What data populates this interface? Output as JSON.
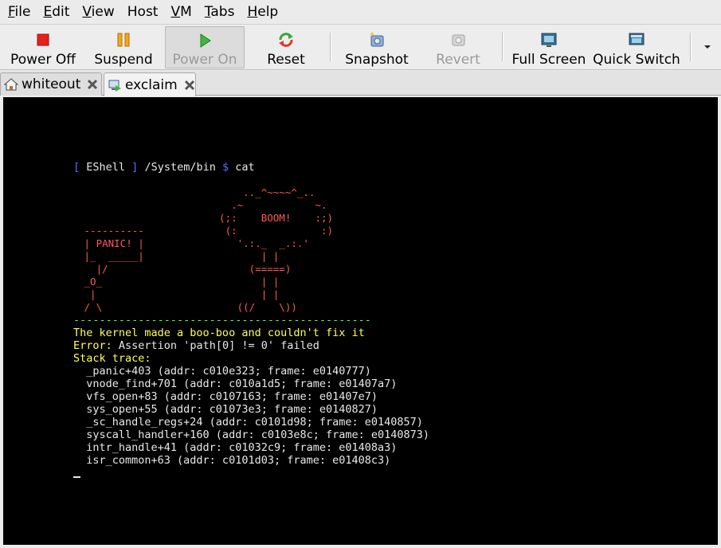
{
  "menu": [
    {
      "u": "F",
      "rest": "ile"
    },
    {
      "u": "E",
      "rest": "dit"
    },
    {
      "u": "V",
      "rest": "iew"
    },
    {
      "u": "H",
      "rest": "ost"
    },
    {
      "u": "V",
      "rest": "M"
    },
    {
      "u": "T",
      "rest": "abs"
    },
    {
      "u": "H",
      "rest": "elp"
    }
  ],
  "toolbar": {
    "power_off": "Power Off",
    "suspend": "Suspend",
    "power_on": "Power On",
    "reset": "Reset",
    "snapshot": "Snapshot",
    "revert": "Revert",
    "full_screen": "Full Screen",
    "quick_switch": "Quick Switch"
  },
  "tabs": [
    {
      "label": "whiteout",
      "icon": "home-icon",
      "active": false
    },
    {
      "label": "exclaim",
      "icon": "vm-icon",
      "active": true
    }
  ],
  "console": {
    "prompt_open": "[ ",
    "prompt_shell": "EShell",
    "prompt_close": " ]",
    "prompt_path": " /System/bin ",
    "prompt_dollar": "$",
    "prompt_cmd": " cat",
    "ascii_panic": " ----------\n | PANIC! |\n |_  _____|\n   |/\n _O_\n  |\n / \\",
    "ascii_boom": "      .._^~~~~^_..\n    .~            ~.\n  (;:    BOOM!    :;)\n   (:              :)\n     '.:._  _.:.'\n         | |\n       (=====)\n         | |\n         | |\n     ((/    \\))",
    "divider": "----------------------------------------------",
    "headline": "The kernel made a boo-boo and couldn't fix it",
    "error_label": "Error:",
    "error_msg": " Assertion 'path[0] != 0' failed",
    "trace_label": "Stack trace:",
    "trace": [
      "  _panic+403 (addr: c010e323; frame: e0140777)",
      "  vnode_find+701 (addr: c010a1d5; frame: e01407a7)",
      "  vfs_open+83 (addr: c0107163; frame: e01407e7)",
      "  sys_open+55 (addr: c01073e3; frame: e0140827)",
      "  _sc_handle_regs+24 (addr: c0101d98; frame: e0140857)",
      "  syscall_handler+160 (addr: c0103e8c; frame: e0140873)",
      "  intr_handle+41 (addr: c01032c9; frame: e01408a3)",
      "  isr_common+63 (addr: c0101d03; frame: e01408c3)"
    ]
  },
  "colors": {
    "console_bg": "#000000",
    "prompt_blue": "#5a6cff",
    "ascii_red": "#ff5a5a",
    "text_yellow": "#ffff55",
    "divider_green": "#55ff55"
  }
}
